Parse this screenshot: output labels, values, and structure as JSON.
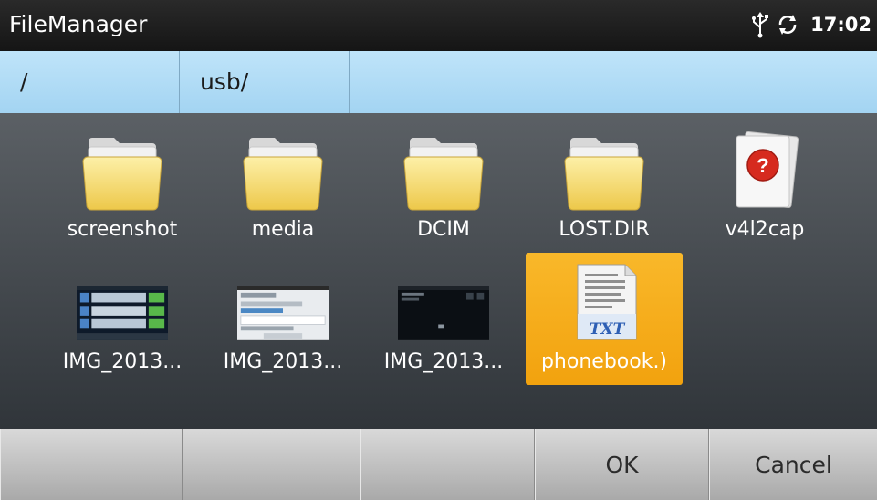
{
  "titlebar": {
    "app_title": "FileManager",
    "clock": "17:02",
    "status_icons": [
      "usb-icon",
      "sync-icon"
    ]
  },
  "path": {
    "crumbs": [
      "/",
      "usb/"
    ]
  },
  "files": [
    {
      "name": "screenshot",
      "type": "folder"
    },
    {
      "name": "media",
      "type": "folder"
    },
    {
      "name": "DCIM",
      "type": "folder"
    },
    {
      "name": "LOST.DIR",
      "type": "folder"
    },
    {
      "name": "v4l2cap",
      "type": "unknown"
    },
    {
      "name": "IMG_2013...",
      "type": "image"
    },
    {
      "name": "IMG_2013...",
      "type": "image"
    },
    {
      "name": "IMG_2013...",
      "type": "image"
    },
    {
      "name": "phonebook.)",
      "type": "text",
      "icon_label": "TXT",
      "selected": true
    }
  ],
  "buttons": {
    "empty1": "",
    "empty2": "",
    "empty3": "",
    "ok": "OK",
    "cancel": "Cancel"
  },
  "colors": {
    "selection": "#f5a81a",
    "pathbar": "#b2dcf6",
    "folder": "#f6dc6c",
    "unknown_badge": "#d62a1e"
  }
}
